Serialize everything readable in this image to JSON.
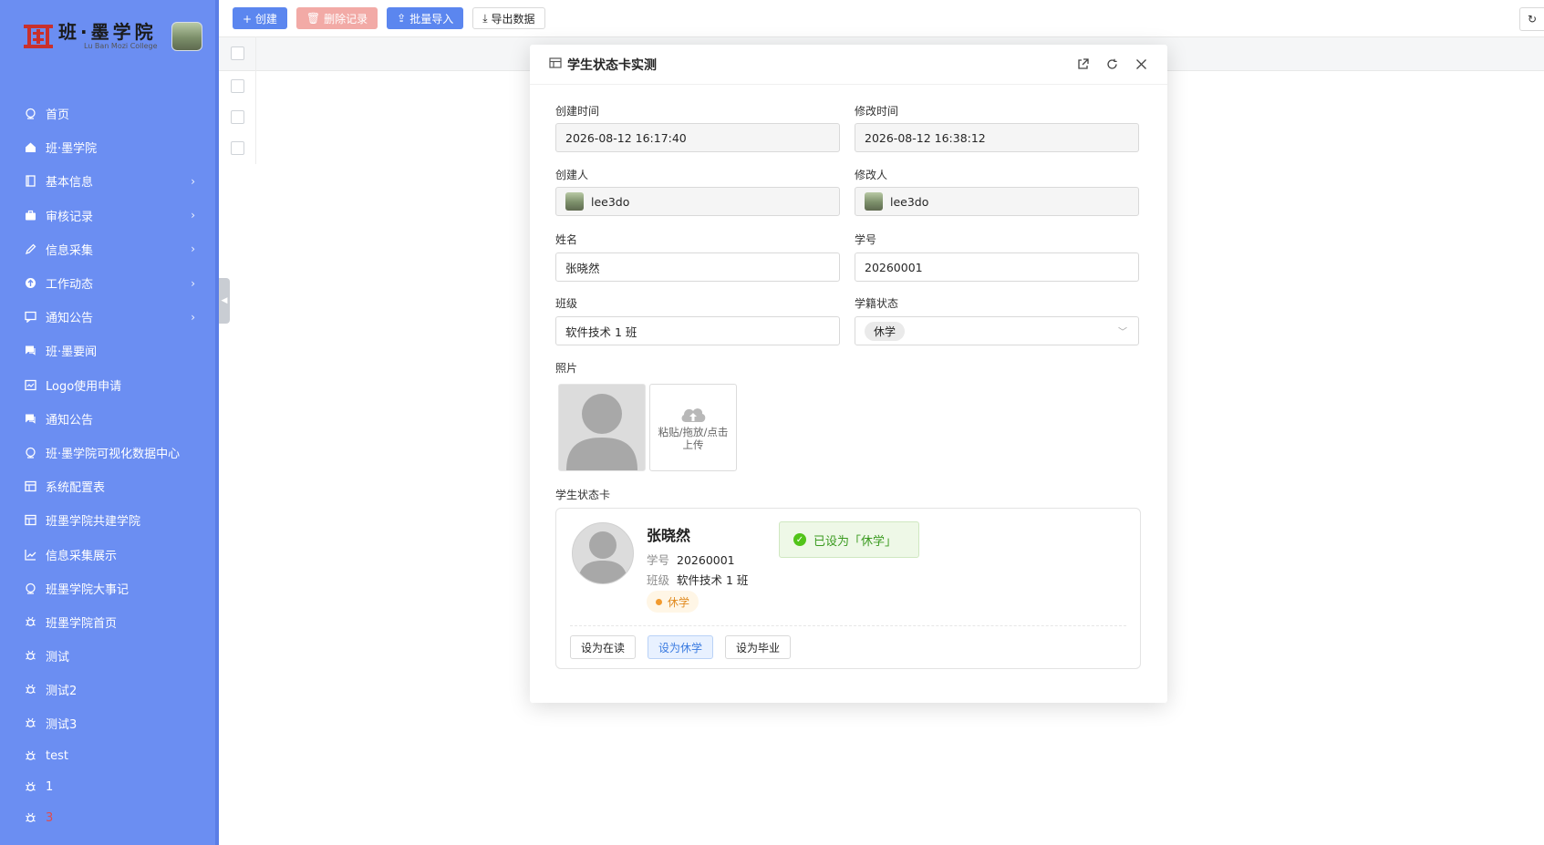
{
  "brand": {
    "name": "班·墨学院",
    "subtitle": "Lu Ban Mozi College"
  },
  "sidebar": {
    "items": [
      {
        "label": "首页",
        "icon": "globe-icon",
        "arrow": false
      },
      {
        "label": "班·墨学院",
        "icon": "home-icon",
        "arrow": false
      },
      {
        "label": "基本信息",
        "icon": "book-icon",
        "arrow": true
      },
      {
        "label": "审核记录",
        "icon": "briefcase-icon",
        "arrow": true
      },
      {
        "label": "信息采集",
        "icon": "pencil-icon",
        "arrow": true
      },
      {
        "label": "工作动态",
        "icon": "upload-circle-icon",
        "arrow": true
      },
      {
        "label": "通知公告",
        "icon": "message-icon",
        "arrow": true
      },
      {
        "label": "班·墨要闻",
        "icon": "chat-icon",
        "arrow": false
      },
      {
        "label": "Logo使用申请",
        "icon": "form-icon",
        "arrow": false
      },
      {
        "label": "通知公告",
        "icon": "chat-icon",
        "arrow": false
      },
      {
        "label": "班·墨学院可视化数据中心",
        "icon": "globe-icon",
        "arrow": false
      },
      {
        "label": "系统配置表",
        "icon": "table-icon",
        "arrow": false
      },
      {
        "label": "班墨学院共建学院",
        "icon": "table-icon",
        "arrow": false
      },
      {
        "label": "信息采集展示",
        "icon": "chart-icon",
        "arrow": false
      },
      {
        "label": "班墨学院大事记",
        "icon": "globe-icon",
        "arrow": false
      },
      {
        "label": "班墨学院首页",
        "icon": "bug-icon",
        "arrow": false
      },
      {
        "label": "测试",
        "icon": "bug-icon",
        "arrow": false
      },
      {
        "label": "测试2",
        "icon": "bug-icon",
        "arrow": false
      },
      {
        "label": "测试3",
        "icon": "bug-icon",
        "arrow": false
      },
      {
        "label": "test",
        "icon": "bug-icon",
        "arrow": false
      },
      {
        "label": "1",
        "icon": "bug-icon",
        "arrow": false
      },
      {
        "label": "3",
        "icon": "bug-icon",
        "arrow": false,
        "color": "#e24b4b"
      }
    ]
  },
  "toolbar": {
    "create": "+ 创建",
    "delete": "删除记录",
    "import": "批量导入",
    "export": "导出数据"
  },
  "modal": {
    "title": "学生状态卡实测",
    "fields": {
      "created_at_label": "创建时间",
      "created_at": "2026-08-12 16:17:40",
      "updated_at_label": "修改时间",
      "updated_at": "2026-08-12 16:38:12",
      "creator_label": "创建人",
      "creator": "lee3do",
      "modifier_label": "修改人",
      "modifier": "lee3do",
      "name_label": "姓名",
      "name": "张晓然",
      "student_no_label": "学号",
      "student_no": "20260001",
      "class_label": "班级",
      "class": "软件技术 1 班",
      "status_label": "学籍状态",
      "status": "休学",
      "photo_label": "照片",
      "upload_text_1": "粘贴/拖放/点击",
      "upload_text_2": "上传",
      "card_label": "学生状态卡"
    },
    "card": {
      "name": "张晓然",
      "no_key": "学号",
      "no": "20260001",
      "class_key": "班级",
      "class": "软件技术 1 班",
      "status": "休学",
      "notice": "已设为「休学」",
      "btn_enrolled": "设为在读",
      "btn_suspend": "设为休学",
      "btn_graduate": "设为毕业"
    }
  },
  "colors": {
    "sidebar": "#6b8ef2",
    "primary": "#5b86ef",
    "danger_disabled": "#f2aaa6",
    "status_orange": "#e08a1e",
    "success_green": "#52c41a"
  }
}
